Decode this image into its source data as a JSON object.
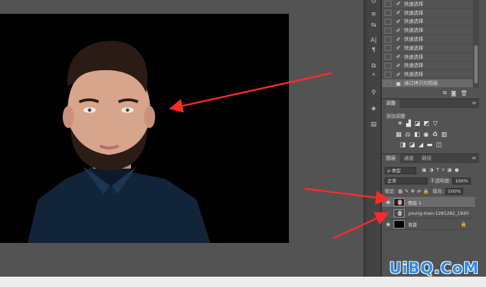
{
  "history": {
    "items": [
      {
        "label": "快速选择"
      },
      {
        "label": "快速选择"
      },
      {
        "label": "快速选择"
      },
      {
        "label": "快速选择"
      },
      {
        "label": "快速选择"
      },
      {
        "label": "快速选择"
      },
      {
        "label": "快速选择"
      },
      {
        "label": "快速选择"
      },
      {
        "label": "快速选择"
      },
      {
        "label": "通过拷贝的图层"
      }
    ]
  },
  "adjustments": {
    "tab": "调整",
    "title": "添加调整"
  },
  "layers": {
    "tabs": [
      "图层",
      "通道",
      "路径"
    ],
    "filter_label": "ρ 类型",
    "blend_mode": "正常",
    "opacity_label": "不透明度:",
    "opacity_value": "100%",
    "lock_label": "锁定:",
    "fill_label": "填充:",
    "fill_value": "100%",
    "items": [
      {
        "name": "图层 1",
        "selected": true
      },
      {
        "name": "young-man-1281282_1920",
        "selected": false
      },
      {
        "name": "背景",
        "selected": false
      }
    ]
  },
  "watermark": "UiBQ.CoM",
  "colors": {
    "arrow": "#ff2a2a",
    "workspace": "#535353",
    "panel": "#535353",
    "selected_row": "#6b6b6b",
    "watermark": "#2d8fe8"
  }
}
